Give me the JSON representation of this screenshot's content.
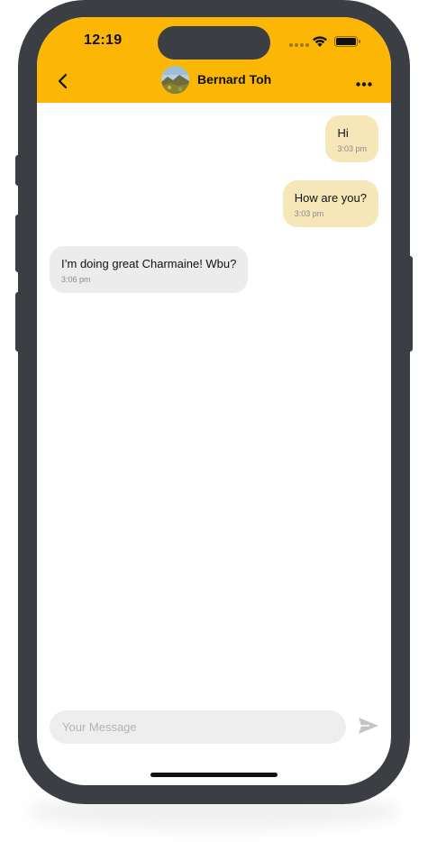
{
  "status_bar": {
    "time": "12:19"
  },
  "chat_header": {
    "back_icon": "chevron-left-icon",
    "contact_name": "Bernard Toh",
    "more_icon": "ellipsis-icon"
  },
  "messages": [
    {
      "direction": "sent",
      "text": "Hi",
      "time": "3:03 pm"
    },
    {
      "direction": "sent",
      "text": "How are you?",
      "time": "3:03 pm"
    },
    {
      "direction": "received",
      "text": "I’m doing great Charmaine! Wbu?",
      "time": "3:06 pm"
    }
  ],
  "composer": {
    "placeholder": "Your Message",
    "value": "",
    "send_icon": "send-icon"
  },
  "colors": {
    "accent": "#fbb606",
    "sent_bubble": "#f6e7b9",
    "received_bubble": "#ececec",
    "frame": "#3b3f44"
  }
}
